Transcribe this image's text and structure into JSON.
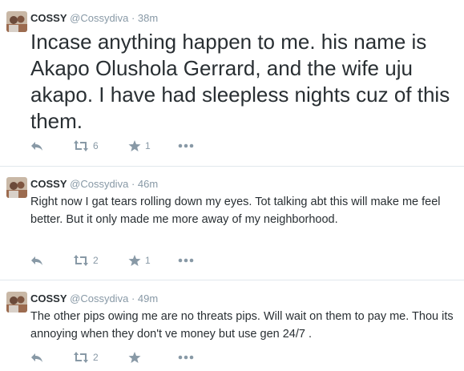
{
  "tweets": [
    {
      "name": "COSSY",
      "handle": "@Cossydiva",
      "time": "38m",
      "text": "Incase anything happen to me. his name is Akapo Olushola Gerrard, and the wife uju akapo. I have had sleepless nights cuz of this them.",
      "retweets": "6",
      "favorites": "1"
    },
    {
      "name": "COSSY",
      "handle": "@Cossydiva",
      "time": "46m",
      "text": "Right now I gat tears rolling down my eyes. Tot talking abt this will make me feel better. But it only made me more away of my neighborhood.",
      "retweets": "2",
      "favorites": "1"
    },
    {
      "name": "COSSY",
      "handle": "@Cossydiva",
      "time": "49m",
      "text": "The other pips owing me are no threats pips. Will wait on them to pay me. Thou its annoying when they don't ve money but use gen 24/7 .",
      "retweets": "2",
      "favorites": ""
    }
  ],
  "separator": "·",
  "colors": {
    "text": "#292f33",
    "muted": "#8899a6",
    "divider": "#e1e8ed"
  },
  "icons": [
    "reply-icon",
    "retweet-icon",
    "favorite-icon",
    "more-icon"
  ]
}
